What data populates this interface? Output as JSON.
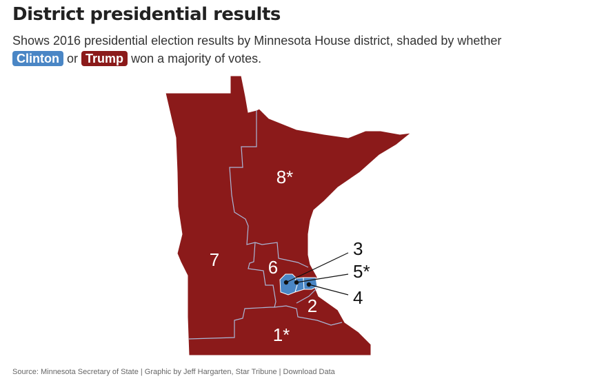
{
  "header": {
    "title": "District presidential results",
    "subtitle_part1": "Shows 2016 presidential election results by Minnesota House district, shaded by whether",
    "clinton_label": "Clinton",
    "or_text": "or",
    "trump_label": "Trump",
    "subtitle_part2": "won a majority of votes."
  },
  "colors": {
    "clinton": "#4a86c5",
    "trump": "#8b1a1a",
    "boundary": "#a9b8d8"
  },
  "districts": [
    {
      "label": "1*",
      "winner": "Trump"
    },
    {
      "label": "2",
      "winner": "Trump"
    },
    {
      "label": "3",
      "winner": "Clinton"
    },
    {
      "label": "4",
      "winner": "Clinton"
    },
    {
      "label": "5*",
      "winner": "Clinton"
    },
    {
      "label": "6",
      "winner": "Trump"
    },
    {
      "label": "7",
      "winner": "Trump"
    },
    {
      "label": "8*",
      "winner": "Trump"
    }
  ],
  "footer": {
    "source": "Source: Minnesota Secretary of State | Graphic by Jeff Hargarten, Star Tribune |",
    "download_label": "Download Data"
  }
}
